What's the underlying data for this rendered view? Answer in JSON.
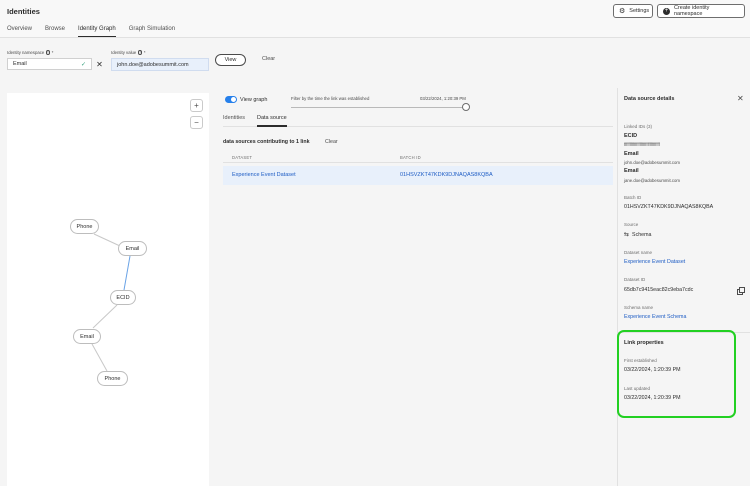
{
  "header": {
    "title": "Identities",
    "tabs": [
      {
        "label": "Overview"
      },
      {
        "label": "Browse"
      },
      {
        "label": "Identity Graph"
      },
      {
        "label": "Graph Simulation"
      }
    ],
    "settings_label": "Settings",
    "create_label": "Create identity namespace"
  },
  "search": {
    "namespace_label": "Identity namespace",
    "namespace_value": "Email",
    "required_mark": "*",
    "value_label": "Identity value",
    "value": "john.doe@adobesummit.com",
    "view_label": "View",
    "clear_label": "Clear"
  },
  "graph": {
    "zoom_in": "+",
    "zoom_out": "−",
    "nodes": [
      "Phone",
      "Email",
      "ECID",
      "Email",
      "Phone"
    ]
  },
  "middle": {
    "view_graph_label": "View graph",
    "view_graph_on": true,
    "filter_label": "Filter by the time the link was established",
    "filter_date": "03/22/2024, 1:20:39 PM",
    "subtabs": [
      "Identities",
      "Data source"
    ],
    "contrib_text": "data sources contributing to 1 link",
    "contrib_clear": "Clear",
    "columns": [
      "DATASET",
      "BATCH ID"
    ],
    "rows": [
      {
        "dataset": "Experience Event Dataset",
        "batch_id": "01HSVZKT47KDK9DJNAQAS8KQBA"
      }
    ]
  },
  "details": {
    "title": "Data source details",
    "linked_ids_label": "Linked IDs (3)",
    "linked": [
      {
        "ns": "ECID",
        "value": "ffffffffffffffffffffffffffffffff"
      },
      {
        "ns": "Email",
        "value": "john.doe@adobesummit.com"
      },
      {
        "ns": "Email",
        "value": "jane.doe@adobesummit.com"
      }
    ],
    "batch_label": "Batch ID",
    "batch_value": "01HSVZKT47KDK9DJNAQAS8KQBA",
    "source_label": "Source",
    "source_value": "Schema",
    "dataset_name_label": "Dataset name",
    "dataset_name": "Experience Event Dataset",
    "dataset_id_label": "Dataset ID",
    "dataset_id": "65db7c9415eac82c9eba7cdc",
    "schema_label": "Schema name",
    "schema_name": "Experience Event Schema",
    "link_props_title": "Link properties",
    "first_label": "First established",
    "first_value": "03/22/2024, 1:20:39 PM",
    "last_label": "Last updated",
    "last_value": "03/22/2024, 1:20:39 PM"
  },
  "colors": {
    "accent": "#2680eb",
    "link": "#1d5cc4",
    "highlight": "#22d022"
  }
}
